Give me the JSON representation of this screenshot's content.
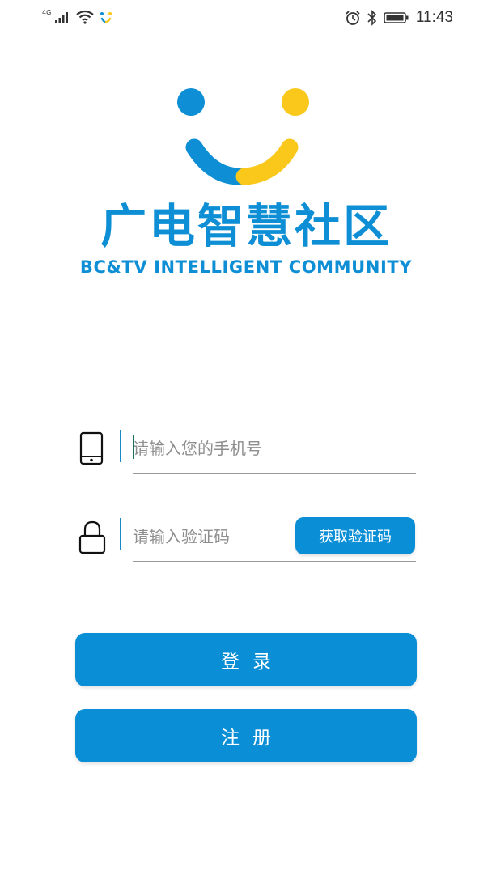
{
  "status_bar": {
    "network_type": "4G",
    "time": "11:43",
    "icons": [
      "signal-icon",
      "wifi-icon",
      "app-notification-icon",
      "alarm-icon",
      "bluetooth-icon",
      "battery-icon"
    ]
  },
  "logo": {
    "title_cn": "广电智慧社区",
    "title_en": "BC&TV INTELLIGENT COMMUNITY",
    "colors": {
      "blue": "#0e8fd5",
      "yellow": "#f9c81b"
    }
  },
  "form": {
    "phone": {
      "placeholder": "请输入您的手机号",
      "value": "",
      "icon": "phone-icon"
    },
    "code": {
      "placeholder": "请输入验证码",
      "value": "",
      "icon": "lock-icon",
      "get_code_label": "获取验证码"
    }
  },
  "actions": {
    "login_label": "登录",
    "register_label": "注册"
  },
  "theme": {
    "accent": "#0a8fd6"
  }
}
